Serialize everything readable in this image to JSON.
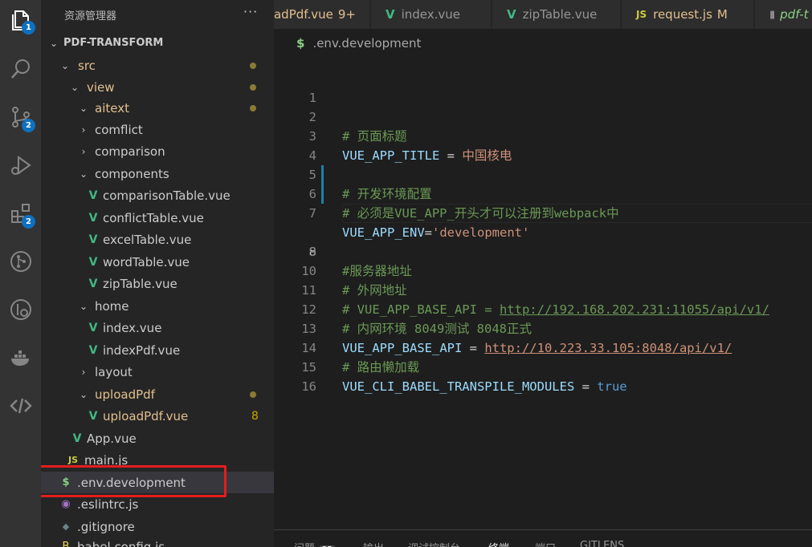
{
  "activity_bar": {
    "explorer_badge": "1",
    "scm_badge": "2",
    "extensions_badge": "2"
  },
  "sidebar": {
    "title": "资源管理器",
    "more": "···",
    "folder": "PDF-TRANSFORM",
    "tree": [
      {
        "label": "src",
        "modified": true
      },
      {
        "label": "view",
        "modified": true
      },
      {
        "label": "aitext",
        "modified": true
      },
      {
        "label": "comflict"
      },
      {
        "label": "comparison"
      },
      {
        "label": "components"
      },
      {
        "label": "comparisonTable.vue"
      },
      {
        "label": "conflictTable.vue"
      },
      {
        "label": "excelTable.vue"
      },
      {
        "label": "wordTable.vue"
      },
      {
        "label": "zipTable.vue"
      },
      {
        "label": "home"
      },
      {
        "label": "index.vue"
      },
      {
        "label": "indexPdf.vue"
      },
      {
        "label": "layout"
      },
      {
        "label": "uploadPdf",
        "modified": true
      },
      {
        "label": "uploadPdf.vue",
        "count": "8"
      },
      {
        "label": "App.vue"
      },
      {
        "label": "main.js"
      },
      {
        "label": ".env.development"
      },
      {
        "label": ".eslintrc.js"
      },
      {
        "label": ".gitignore"
      },
      {
        "label": "babel.config.js"
      }
    ]
  },
  "tabs": [
    {
      "label": "uploadPdf.vue",
      "badge": "9+"
    },
    {
      "label": "index.vue"
    },
    {
      "label": "zipTable.vue"
    },
    {
      "label": "request.js",
      "badge": "M"
    },
    {
      "label": "pdf-t"
    }
  ],
  "breadcrumb": ".env.development",
  "editor": {
    "current_line": 8,
    "lines": [
      {
        "n": "1"
      },
      {
        "n": "2",
        "comment": "# 页面标题"
      },
      {
        "n": "3",
        "key": "VUE_APP_TITLE",
        "op": " = ",
        "value": "中国核电"
      },
      {
        "n": "4"
      },
      {
        "n": "5",
        "comment": "# 开发环境配置"
      },
      {
        "n": "6",
        "comment": "# 必须是VUE_APP_开头才可以注册到webpack中"
      },
      {
        "n": "7",
        "key": "VUE_APP_ENV",
        "op": "=",
        "value": "'development'"
      },
      {
        "n": "8"
      },
      {
        "n": "9",
        "comment": "#服务器地址"
      },
      {
        "n": "10",
        "comment": "# 外网地址"
      },
      {
        "n": "11",
        "comment": "# VUE_APP_BASE_API = ",
        "comment_url": "http://192.168.202.231:11055/api/v1/"
      },
      {
        "n": "12",
        "comment": "# 内网环境 8049测试 8048正式"
      },
      {
        "n": "13",
        "key": "VUE_APP_BASE_API",
        "op": " = ",
        "url": "http://10.223.33.105:8048/api/v1/"
      },
      {
        "n": "14",
        "comment": "# 路由懒加载"
      },
      {
        "n": "15",
        "key": "VUE_CLI_BABEL_TRANSPILE_MODULES",
        "op": " = ",
        "bool": "true"
      },
      {
        "n": "16"
      }
    ]
  },
  "panel": {
    "problems": "问题",
    "problems_count": "25",
    "output": "输出",
    "debug_console": "调试控制台",
    "terminal": "终端",
    "ports": "端口",
    "gitlens": "GITLENS"
  },
  "colors": {
    "accent": "#0e70c0",
    "vue": "#41b883",
    "modified": "#e2c08d",
    "highlight_box": "#e51c1c"
  }
}
